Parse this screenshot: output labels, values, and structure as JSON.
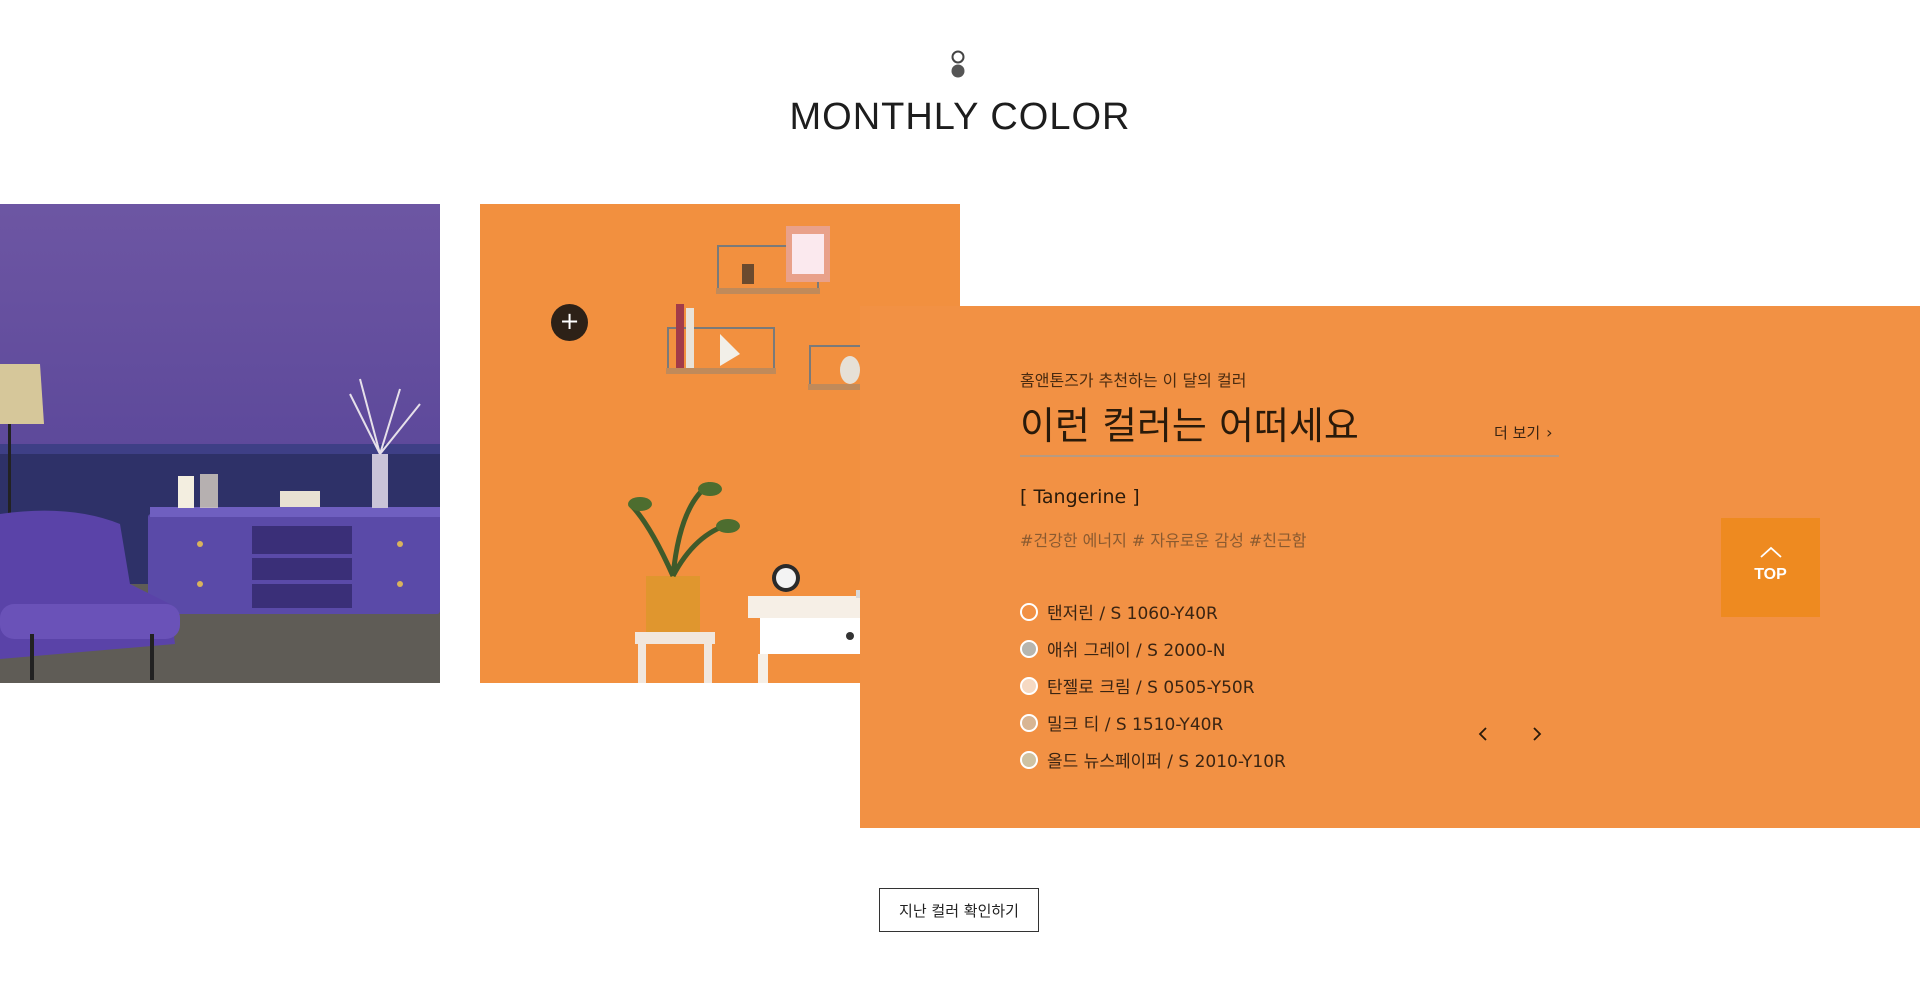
{
  "section": {
    "title": "MONTHLY COLOR"
  },
  "images": [
    {
      "name": "purple room with sideboard and armchair",
      "accent": "#5c489a"
    },
    {
      "name": "tangerine wall with shelves, plant and desk",
      "accent": "#f2903f"
    }
  ],
  "panel": {
    "background": "#f29144",
    "subtitle": "홈앤톤즈가 추천하는 이 달의 컬러",
    "heading": "이런 컬러는 어떠세요",
    "more_label": "더 보기",
    "color_name": "[ Tangerine ]",
    "hashtags": "#건강한 에너지 # 자유로운 감성 #친근함",
    "swatches": [
      {
        "label": "탠저린 / S 1060-Y40R",
        "color": "#f29144"
      },
      {
        "label": "애쉬 그레이 / S 2000-N",
        "color": "#b7b5ae"
      },
      {
        "label": "탄젤로 크림 / S 0505-Y50R",
        "color": "#f6d9c2"
      },
      {
        "label": "밀크 티 / S 1510-Y40R",
        "color": "#d8b593"
      },
      {
        "label": "올드 뉴스페이퍼 / S 2010-Y10R",
        "color": "#cfc2a2"
      }
    ],
    "prev_icon": "chevron-left-icon",
    "next_icon": "chevron-right-icon"
  },
  "top_button": {
    "label": "TOP",
    "color": "#ee8a20"
  },
  "past_colors_label": "지난 컬러 확인하기"
}
